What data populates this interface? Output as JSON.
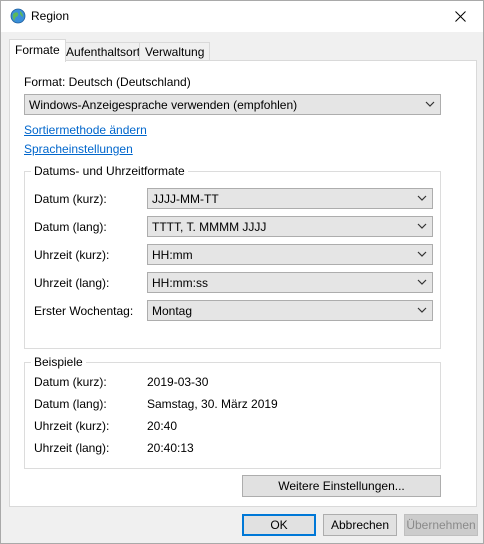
{
  "window": {
    "title": "Region",
    "icon": "globe-icon",
    "close_icon": "close-icon"
  },
  "tabs": [
    {
      "label": "Formate",
      "active": true
    },
    {
      "label": "Aufenthaltsort",
      "active": false
    },
    {
      "label": "Verwaltung",
      "active": false
    }
  ],
  "format": {
    "label": "Format: Deutsch (Deutschland)",
    "selected": "Windows-Anzeigesprache verwenden (empfohlen)"
  },
  "links": {
    "sort_method": "Sortiermethode ändern",
    "language_settings": "Spracheinstellungen"
  },
  "date_time_formats": {
    "title": "Datums- und Uhrzeitformate",
    "rows": [
      {
        "label": "Datum (kurz):",
        "value": "JJJJ-MM-TT"
      },
      {
        "label": "Datum (lang):",
        "value": "TTTT, T. MMMM JJJJ"
      },
      {
        "label": "Uhrzeit (kurz):",
        "value": "HH:mm"
      },
      {
        "label": "Uhrzeit (lang):",
        "value": "HH:mm:ss"
      },
      {
        "label": "Erster Wochentag:",
        "value": "Montag"
      }
    ]
  },
  "examples": {
    "title": "Beispiele",
    "rows": [
      {
        "label": "Datum (kurz):",
        "value": "2019-03-30"
      },
      {
        "label": "Datum (lang):",
        "value": "Samstag, 30. März 2019"
      },
      {
        "label": "Uhrzeit (kurz):",
        "value": "20:40"
      },
      {
        "label": "Uhrzeit (lang):",
        "value": "20:40:13"
      }
    ]
  },
  "buttons": {
    "more_settings": "Weitere Einstellungen...",
    "ok": "OK",
    "cancel": "Abbrechen",
    "apply": "Übernehmen"
  },
  "colors": {
    "link": "#0066cc",
    "default_button_border": "#0078d7"
  }
}
